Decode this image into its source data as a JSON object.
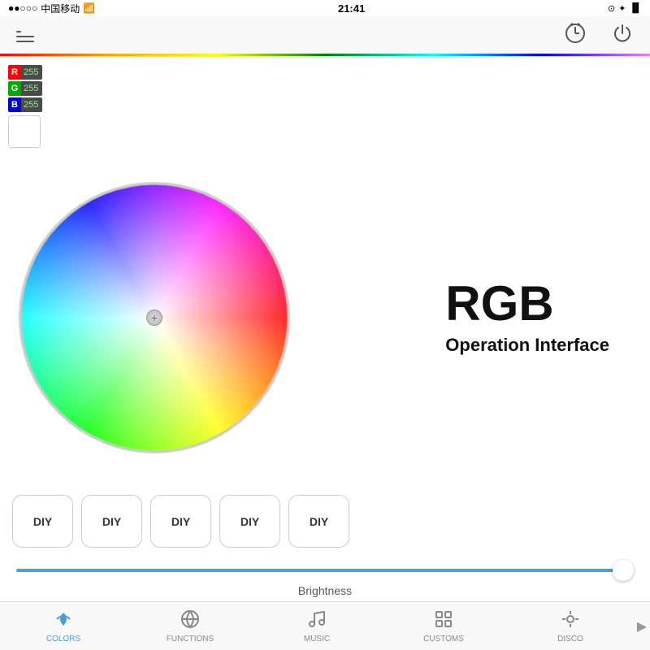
{
  "status_bar": {
    "signal": "●●○○○",
    "carrier": "中国移动",
    "wifi": "WiFi",
    "time": "21:41",
    "lock": "⊙",
    "bluetooth": "✦",
    "battery": "🔋"
  },
  "rgb": {
    "r_label": "R",
    "g_label": "G",
    "b_label": "B",
    "r_value": "255",
    "g_value": "255",
    "b_value": "255"
  },
  "wheel": {
    "center_symbol": "+"
  },
  "rgb_display": {
    "title": "RGB",
    "subtitle": "Operation Interface"
  },
  "diy_buttons": [
    {
      "label": "DIY"
    },
    {
      "label": "DIY"
    },
    {
      "label": "DIY"
    },
    {
      "label": "DIY"
    },
    {
      "label": "DIY"
    }
  ],
  "brightness": {
    "label": "Brightness"
  },
  "tabs": [
    {
      "id": "colors",
      "label": "COLORS",
      "active": true
    },
    {
      "id": "functions",
      "label": "FUNCTIONS",
      "active": false
    },
    {
      "id": "music",
      "label": "MUSIC",
      "active": false
    },
    {
      "id": "customs",
      "label": "CUSTOMS",
      "active": false
    },
    {
      "id": "disco",
      "label": "DISCO",
      "active": false
    }
  ]
}
